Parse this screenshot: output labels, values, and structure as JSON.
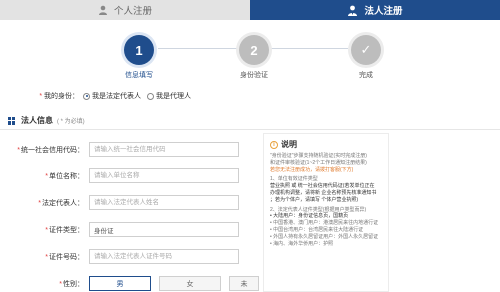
{
  "tabs": {
    "personal": "个人注册",
    "legal": "法人注册"
  },
  "steps": [
    {
      "number": "1",
      "label": "信息填写"
    },
    {
      "number": "2",
      "label": "身份验证"
    },
    {
      "number": "✓",
      "label": "完成"
    }
  ],
  "identity": {
    "label": "我的身份",
    "options": [
      "我是法定代表人",
      "我是代理人"
    ],
    "selected": "我是法定代表人"
  },
  "section": {
    "title": "法人信息",
    "note": "( * 为必填)"
  },
  "form": {
    "credit_code": {
      "label": "统一社会信用代码",
      "placeholder": "请输入统一社会信用代码"
    },
    "company_name": {
      "label": "单位名称",
      "placeholder": "请输入单位名称"
    },
    "legal_rep": {
      "label": "法定代表人",
      "placeholder": "请输入法定代表人姓名"
    },
    "cert_type": {
      "label": "证件类型",
      "value": "身份证"
    },
    "cert_number": {
      "label": "证件号码",
      "placeholder": "请输入法定代表人证件号码"
    },
    "gender": {
      "label": "性别",
      "options": [
        "男",
        "女",
        "未"
      ],
      "selected": "男"
    }
  },
  "help": {
    "title": "说明",
    "lines": [
      {
        "text": "\"身份验证\"步骤支持随机验证(实时完成注册)",
        "kind": "normal"
      },
      {
        "text": "和证件审核验证(1~2个工作日通知注册结果)",
        "kind": "normal"
      },
      {
        "text": "若您无法注册成功，请拨打客服(下方)",
        "kind": "warn"
      },
      {
        "text": "",
        "kind": "space"
      },
      {
        "text": "1、单位有效证件类型",
        "kind": "normal"
      },
      {
        "text": "营业执照 或 统一社会信用代码证(若发单位正在",
        "kind": "strong"
      },
      {
        "text": "办理机构调整，请将新 企业名称预先核准通知书",
        "kind": "strong"
      },
      {
        "text": "；若为个体户，请填写 个体户营业执照)",
        "kind": "strong"
      },
      {
        "text": "",
        "kind": "space"
      },
      {
        "text": "2、法定代表人证件类型(根据用户类型而异)",
        "kind": "normal"
      },
      {
        "text": "• 大陆用户：身份证信息页，国籍页",
        "kind": "strong"
      },
      {
        "text": "• 中国香港、澳门用户：港澳居民来往内地通行证",
        "kind": "li"
      },
      {
        "text": "• 中国台湾用户：台湾居民来往大陆通行证",
        "kind": "li"
      },
      {
        "text": "• 外国人持有永久居留证用户：外国人永久居留证",
        "kind": "li"
      },
      {
        "text": "• 海内、海外华侨用户：护照",
        "kind": "li"
      }
    ]
  }
}
